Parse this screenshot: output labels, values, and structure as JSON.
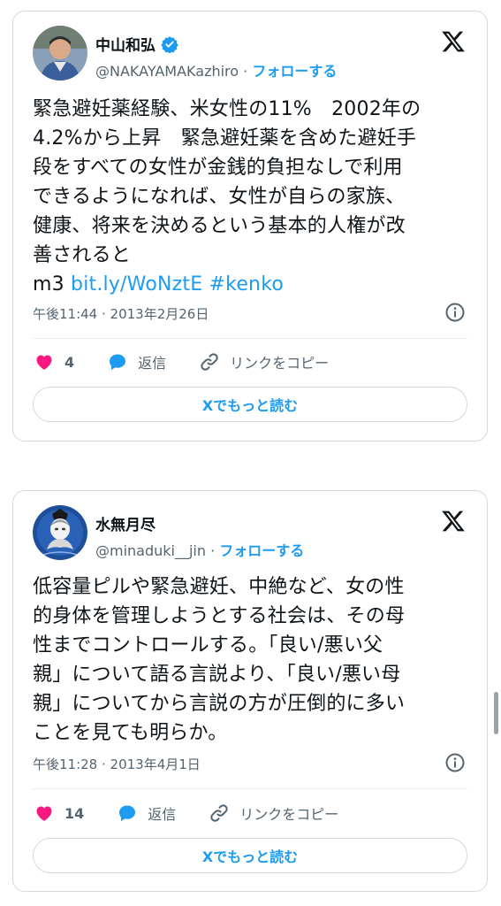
{
  "tweets": [
    {
      "author_name": "中山和弘",
      "handle": "@NAKAYAMAKazhiro",
      "follow_label": "フォローする",
      "verified": true,
      "text": "緊急避妊薬経験、米女性の11%　2002年の\n4.2%から上昇　緊急避妊薬を含めた避妊手\n段をすべての女性が金銭的負担なしで利用\nできるようになれば、女性が自らの家族、\n健康、将来を決めるという基本的人権が改\n善されると",
      "text_tail_prefix": "m3 ",
      "link": "bit.ly/WoNztE",
      "hashtag": "#kenko",
      "timestamp": "午後11:44 · 2013年2月26日",
      "likes": "4",
      "reply_label": "返信",
      "copy_label": "リンクをコピー",
      "read_more_label": "Xでもっと読む"
    },
    {
      "author_name": "水無月尽",
      "handle": "@minaduki__jin",
      "follow_label": "フォローする",
      "verified": false,
      "text": "低容量ピルや緊急避妊、中絶など、女の性\n的身体を管理しようとする社会は、その母\n性までコントロールする。「良い/悪い父\n親」について語る言説より、「良い/悪い母\n親」についてから言説の方が圧倒的に多い\nことを見ても明らか。",
      "timestamp": "午後11:28 · 2013年4月1日",
      "likes": "14",
      "reply_label": "返信",
      "copy_label": "リンクをコピー",
      "read_more_label": "Xでもっと読む"
    }
  ],
  "colors": {
    "accent": "#1d9bf0",
    "like": "#f91880",
    "secondary_text": "#536471",
    "border": "#cfd9de"
  }
}
